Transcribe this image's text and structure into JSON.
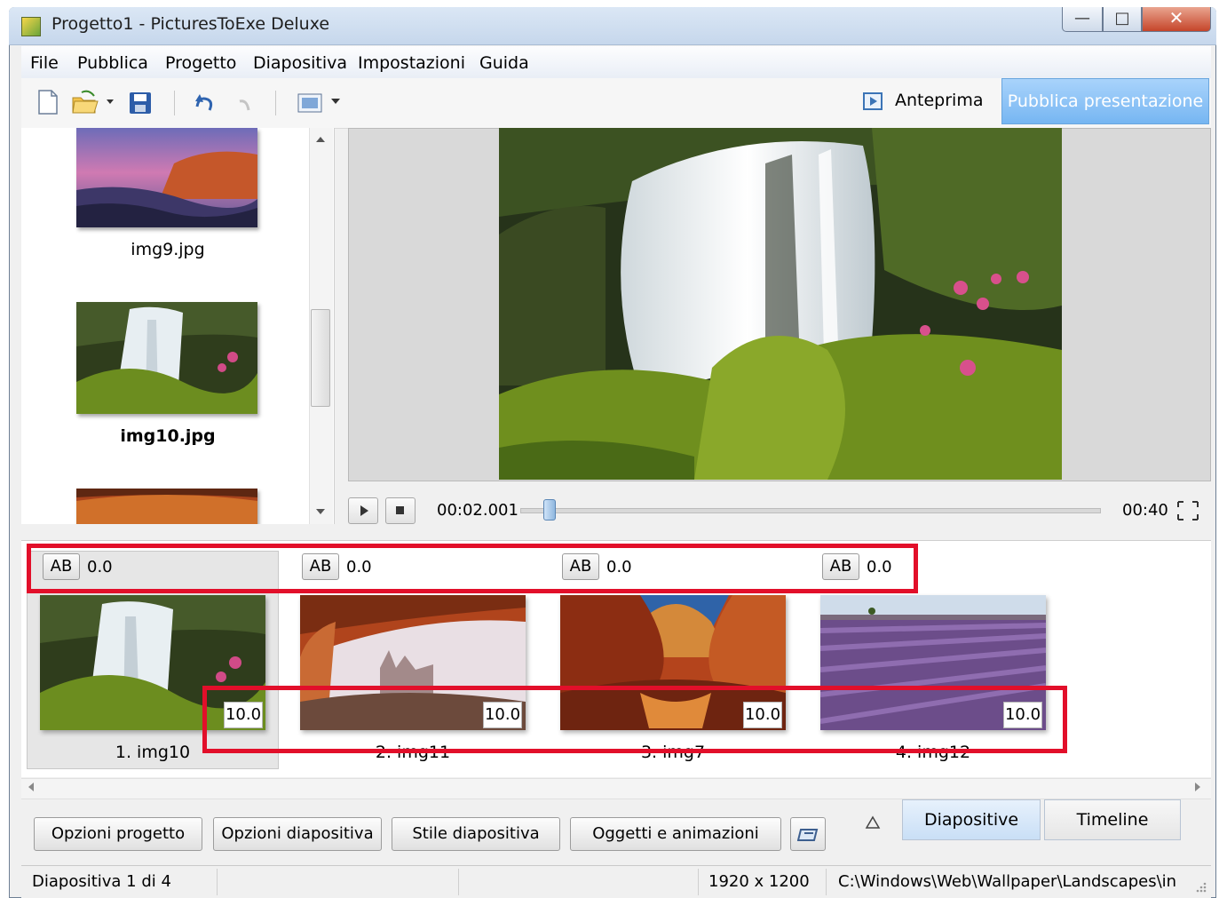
{
  "window": {
    "title": "Progetto1 - PicturesToExe Deluxe"
  },
  "menu": [
    "File",
    "Pubblica",
    "Progetto",
    "Diapositiva",
    "Impostazioni",
    "Guida"
  ],
  "toolbar": {
    "preview_label": "Anteprima",
    "publish_label": "Pubblica presentazione"
  },
  "slide_list": {
    "items": [
      {
        "label": "img9.jpg"
      },
      {
        "label": "img10.jpg",
        "selected": true
      },
      {
        "label": ""
      }
    ]
  },
  "player": {
    "current_time": "00:02.001",
    "total_time": "00:40",
    "progress": 0.05
  },
  "strip": {
    "slides": [
      {
        "transition_label": "AB",
        "transition_time": "0.0",
        "duration": "10.0",
        "label": "1. img10"
      },
      {
        "transition_label": "AB",
        "transition_time": "0.0",
        "duration": "10.0",
        "label": "2. img11"
      },
      {
        "transition_label": "AB",
        "transition_time": "0.0",
        "duration": "10.0",
        "label": "3. img7"
      },
      {
        "transition_label": "AB",
        "transition_time": "0.0",
        "duration": "10.0",
        "label": "4. img12"
      }
    ]
  },
  "bottom": {
    "buttons": [
      "Opzioni progetto",
      "Opzioni diapositiva",
      "Stile diapositiva",
      "Oggetti e animazioni"
    ],
    "tabs": [
      "Diapositive",
      "Timeline"
    ]
  },
  "status": {
    "slide_of": "Diapositiva 1 di 4",
    "resolution": "1920 x 1200",
    "path": "C:\\Windows\\Web\\Wallpaper\\Landscapes\\in"
  },
  "colors": {
    "highlight_red": "#e20f2a",
    "publish_blue": "#76b6f2"
  }
}
